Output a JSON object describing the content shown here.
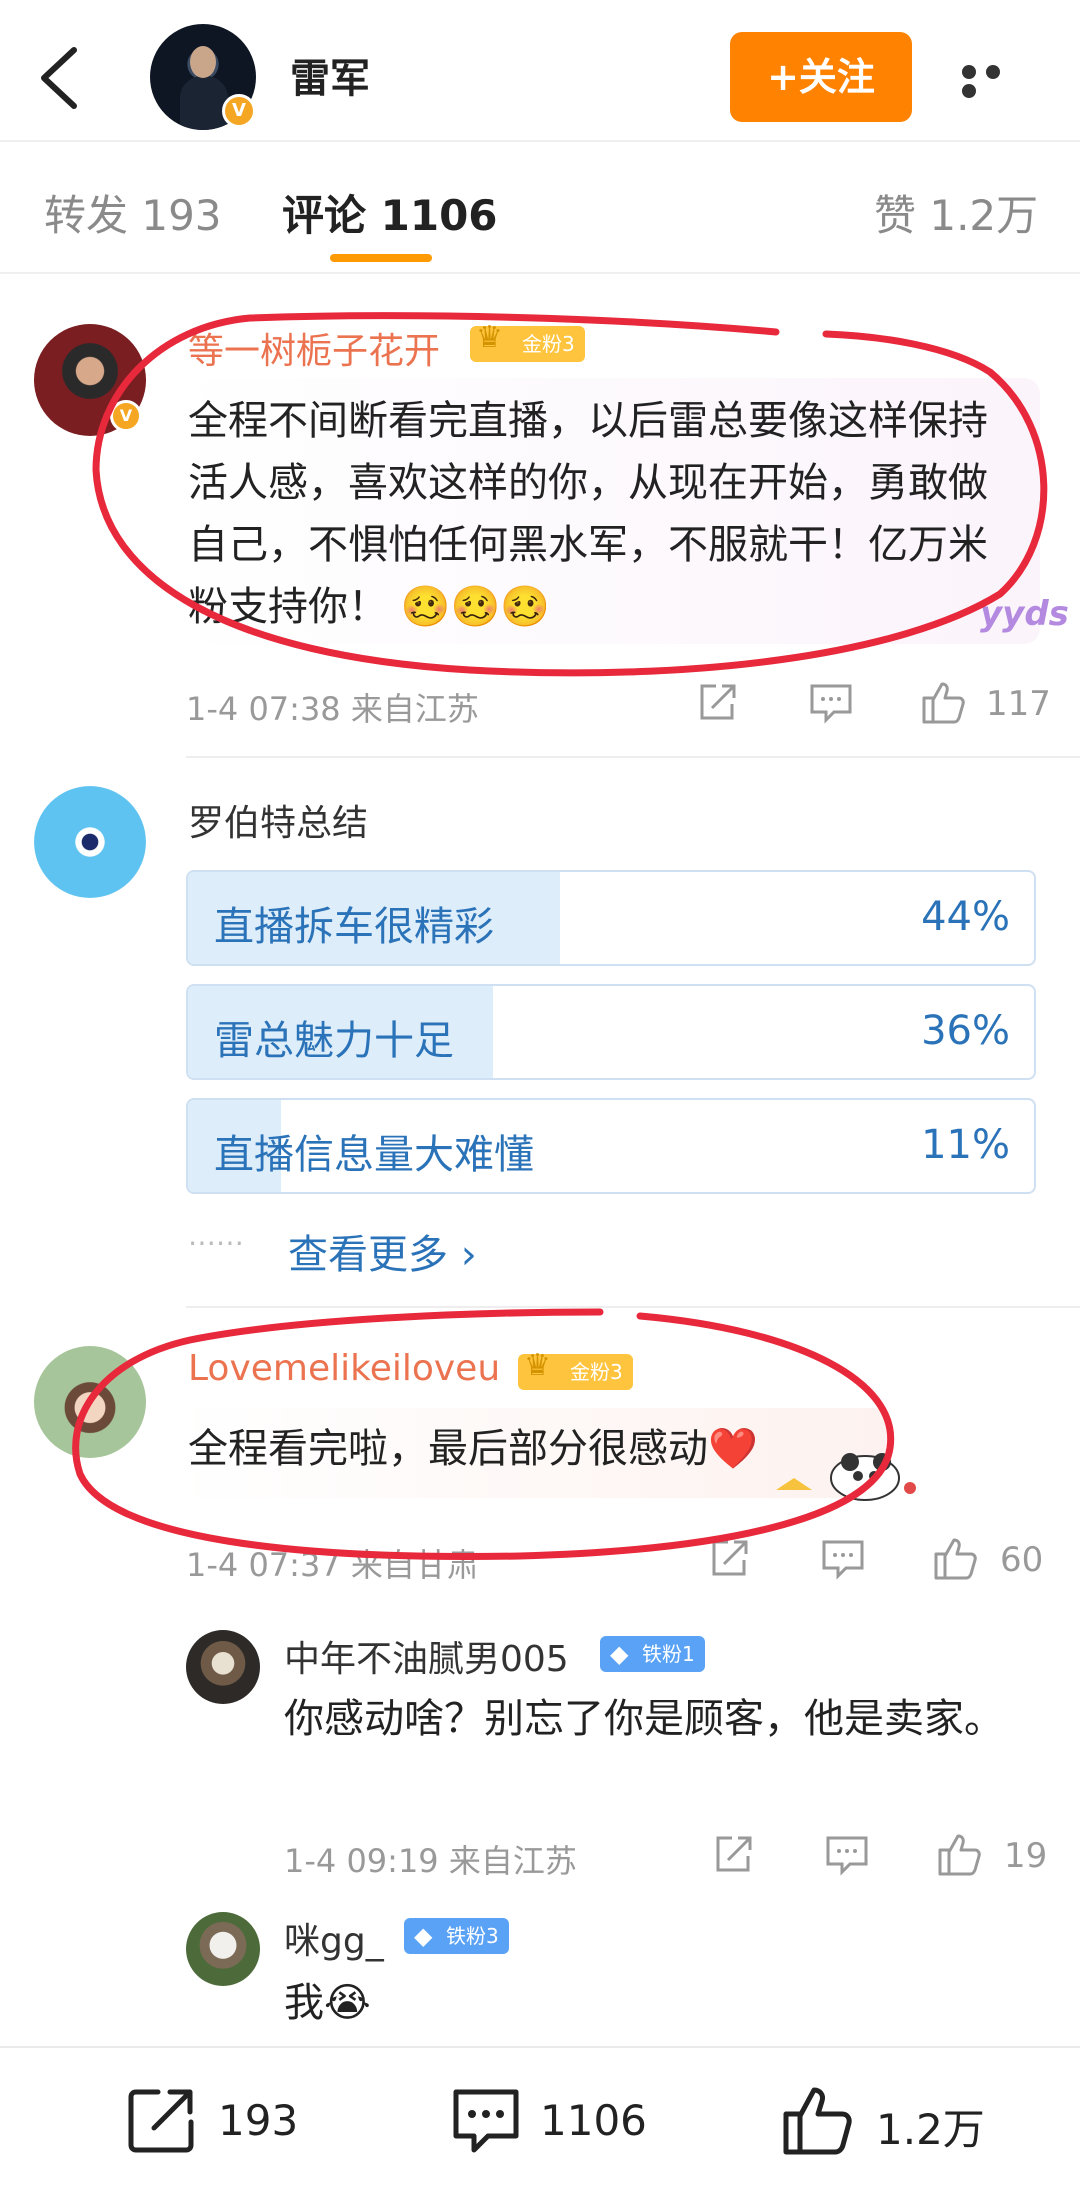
{
  "header": {
    "title": "雷军",
    "follow_label": "+关注",
    "verified_mark": "V"
  },
  "tabs": [
    {
      "label": "转发 193"
    },
    {
      "label": "评论 1106"
    },
    {
      "label": "赞 1.2万"
    }
  ],
  "comments": [
    {
      "user": "等一树栀子花开",
      "badge": "金粉3",
      "text": "全程不间断看完直播，以后雷总要像这样保持活人感，喜欢这样的你，从现在开始，勇敢做自己，不惧怕任何黑水军，不服就干！亿万米粉支持你！",
      "emoji": "🥴🥴🥴",
      "sticker": "yyds",
      "meta": "1-4 07:38 来自江苏",
      "likes": "117"
    },
    {
      "user": "罗伯特总结",
      "poll": [
        {
          "label": "直播拆车很精彩",
          "percent": "44%",
          "value": 0.44
        },
        {
          "label": "雷总魅力十足",
          "percent": "36%",
          "value": 0.36
        },
        {
          "label": "直播信息量大难懂",
          "percent": "11%",
          "value": 0.11
        }
      ],
      "see_more": "查看更多 ›",
      "dots": "⋯⋯"
    },
    {
      "user": "Lovemelikeiloveu",
      "badge": "金粉3",
      "text": "全程看完啦，最后部分很感动",
      "emoji": "❤️",
      "meta": "1-4 07:37 来自甘肃",
      "likes": "60"
    }
  ],
  "replies": [
    {
      "user": "中年不油腻男005",
      "badge": "铁粉1",
      "text": "你感动啥？别忘了你是顾客，他是卖家。",
      "meta": "1-4 09:19 来自江苏",
      "likes": "19"
    },
    {
      "user": "咪gg_",
      "badge": "铁粉3",
      "text": "我",
      "emoji": "😭"
    }
  ],
  "bottom_bar": {
    "repost_count": "193",
    "comment_count": "1106",
    "like_count": "1.2万"
  }
}
